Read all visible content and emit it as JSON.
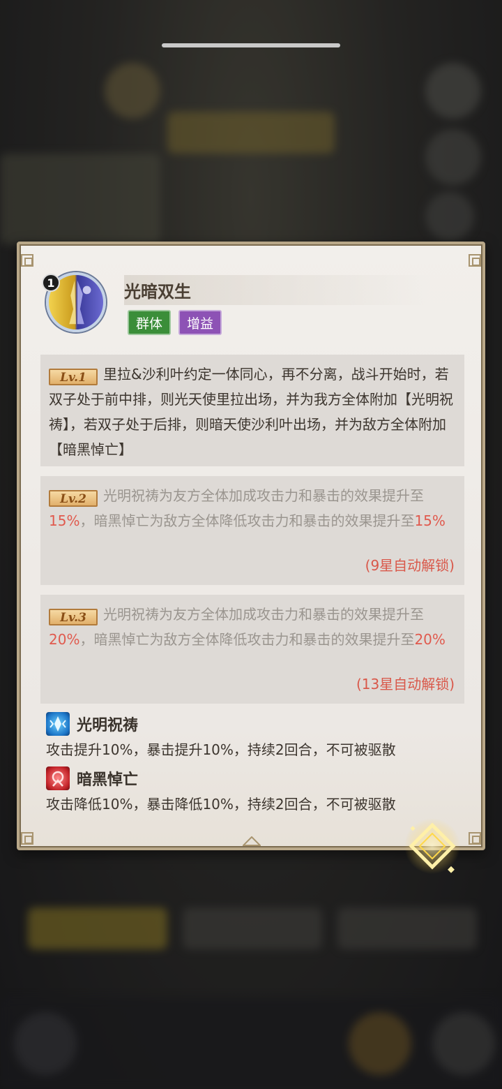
{
  "skill": {
    "index": "1",
    "name": "光暗双生",
    "tags": [
      "群体",
      "增益"
    ]
  },
  "levels": [
    {
      "badge": "Lv.1",
      "text": "里拉&沙利叶约定一体同心，再不分离，战斗开始时，若双子处于前中排，则光天使里拉出场，并为我方全体附加【光明祝祷】，若双子处于后排，则暗天使沙利叶出场，并为敌方全体附加【暗黑悼亡】"
    },
    {
      "badge": "Lv.2",
      "text_a": "光明祝祷为友方全体加成攻击力和暴击的效果提升至",
      "value_a": "15%",
      "text_b": "，暗黑悼亡为敌方全体降低攻击力和暴击的效果提升至",
      "value_b": "15%",
      "unlock": "(9星自动解锁)"
    },
    {
      "badge": "Lv.3",
      "text_a": "光明祝祷为友方全体加成攻击力和暴击的效果提升至",
      "value_a": "20%",
      "text_b": "，暗黑悼亡为敌方全体降低攻击力和暴击的效果提升至",
      "value_b": "20%",
      "unlock": "(13星自动解锁)"
    }
  ],
  "effects": [
    {
      "icon": "light-blessing-icon",
      "name": "光明祝祷",
      "desc": "攻击提升10%，暴击提升10%，持续2回合，不可被驱散",
      "color": "#1c76c8"
    },
    {
      "icon": "dark-mourning-icon",
      "name": "暗黑悼亡",
      "desc": "攻击降低10%，暴击降低10%，持续2回合，不可被驱散",
      "color": "#c4242a"
    }
  ],
  "colors": {
    "highlight": "#e05a4e",
    "tag_green": "#3b8e39",
    "tag_purple": "#8d52b5"
  }
}
